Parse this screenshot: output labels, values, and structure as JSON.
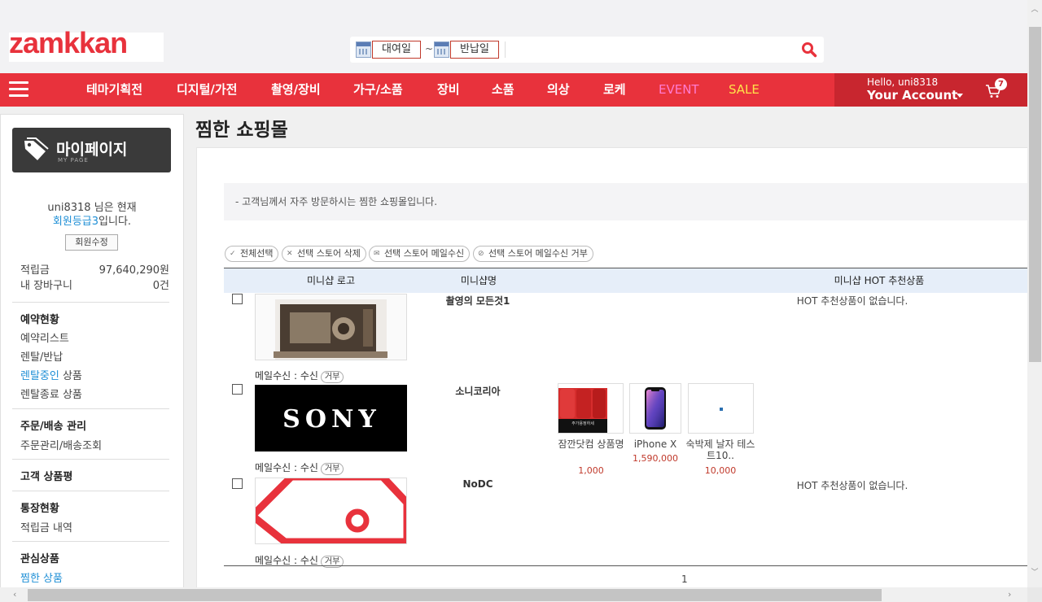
{
  "header": {
    "logo_text": "zamkkan",
    "date_from": "대여일",
    "tilde": "~",
    "date_to": "반납일",
    "search_value": ""
  },
  "nav": {
    "items": [
      "테마기획전",
      "디지털/가전",
      "촬영/장비",
      "가구/소품",
      "장비",
      "소품",
      "의상",
      "로케",
      "EVENT",
      "SALE"
    ],
    "event_color": "#ff7bd0",
    "sale_color": "#ffe24a"
  },
  "account": {
    "hello": "Hello, uni8318",
    "your_account": "Your Account",
    "cart_count": "7"
  },
  "sidebar": {
    "mypage_title": "마이페이지",
    "mypage_sub": "MY PAGE",
    "user_line1": "uni8318 님은 현재",
    "grade": "회원등급3",
    "grade_suffix": "입니다.",
    "modify_button": "회원수정",
    "points_label": "적립금",
    "points_value": "97,640,290원",
    "cart_label": "내 장바구니",
    "cart_value": "0건",
    "sec_reservation": "예약현황",
    "reservation_list": "예약리스트",
    "rental_return": "렌탈/반납",
    "renting": "렌탈중인",
    "renting_suffix": " 상품",
    "rental_done": "렌탈종료 상품",
    "sec_order": "주문/배송 관리",
    "order_lookup": "주문관리/배송조회",
    "sec_review": "고객 상품평",
    "sec_account": "통장현황",
    "points_history": "적립금 내역",
    "sec_interest": "관심상품",
    "wished": "찜한 상품"
  },
  "main": {
    "title": "찜한 쇼핑몰",
    "notice": "- 고객님께서 자주 방문하시는 찜한 쇼핑몰입니다.",
    "toolbar": [
      "전체선택",
      "선택 스토어 삭제",
      "선택 스토어 메일수신",
      "선택 스토어 메일수신 거부"
    ],
    "columns": [
      "미니샵 로고",
      "미니샵명",
      "미니샵 HOT 추천상품"
    ],
    "rows": [
      {
        "name": "촬영의 모든것1",
        "mail_label": "메일수신 : 수신",
        "reject": "거부",
        "hot_empty": "HOT 추천상품이 없습니다."
      },
      {
        "name": "소니코리아",
        "mail_label": "메일수신 : 수신",
        "reject": "거부",
        "logo_text": "SONY",
        "products": [
          {
            "name": "잠깐닷컴 상품명",
            "price": "1,000",
            "thumb_text": "주가용정하세"
          },
          {
            "name": "iPhone X",
            "price": "1,590,000"
          },
          {
            "name": "숙박제 날자 테스트10..",
            "price": "10,000"
          }
        ]
      },
      {
        "name": "NoDC",
        "mail_label": "메일수신 : 수신",
        "reject": "거부",
        "hot_empty": "HOT 추천상품이 없습니다."
      }
    ],
    "page": "1"
  }
}
